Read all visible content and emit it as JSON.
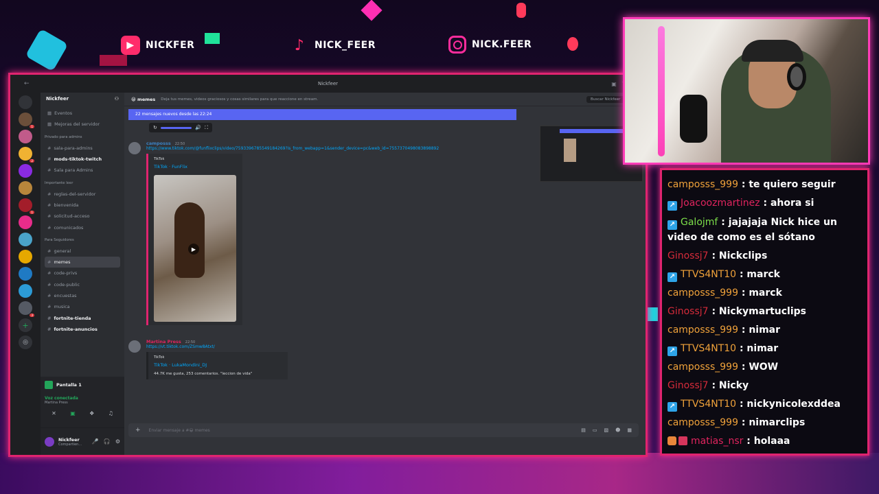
{
  "socials": {
    "youtube": "NICKFER",
    "tiktok": "NICK_FEER",
    "instagram": "NICK.FEER"
  },
  "discord": {
    "window_title": "Nickfeer",
    "server_name": "Nickfeer",
    "channels": [
      {
        "type": "item",
        "label": "Eventos"
      },
      {
        "type": "item",
        "label": "Mejoras del servidor"
      },
      {
        "type": "header",
        "label": "Privado para admins"
      },
      {
        "type": "channel",
        "label": "sala-para-admins"
      },
      {
        "type": "channel",
        "label": "mods-tiktok-twitch",
        "bold": true
      },
      {
        "type": "channel",
        "label": "Sala para Admins"
      },
      {
        "type": "header",
        "label": "Importante leer"
      },
      {
        "type": "channel",
        "label": "reglas-del-servidor"
      },
      {
        "type": "channel",
        "label": "bienvenida"
      },
      {
        "type": "channel",
        "label": "solicitud-acceso"
      },
      {
        "type": "channel",
        "label": "comunicados"
      },
      {
        "type": "header",
        "label": "Para Seguidores"
      },
      {
        "type": "channel",
        "label": "general"
      },
      {
        "type": "channel",
        "label": "memes",
        "active": true
      },
      {
        "type": "channel",
        "label": "code-privs"
      },
      {
        "type": "channel",
        "label": "code-public"
      },
      {
        "type": "channel",
        "label": "encuestas"
      },
      {
        "type": "channel",
        "label": "musica"
      },
      {
        "type": "channel",
        "label": "fortnite-tienda",
        "bold": true
      },
      {
        "type": "channel",
        "label": "fortnite-anuncios",
        "bold": true
      }
    ],
    "voice": {
      "title": "Pantalla 1",
      "status": "Voz conectada",
      "channel": "Martina Press"
    },
    "user": {
      "name": "Nickfeer",
      "status": "Compartien..."
    },
    "chat": {
      "channel": "memes",
      "topic": "Deja tus memes, videos graciosos y cosas similares para que reaccione en stream.",
      "search_placeholder": "Buscar Nickfeer",
      "new_messages": "22 mensajes nuevos desde las 22:24",
      "msg1": {
        "author": "camposss",
        "time": "22:50",
        "link": "https://www.tiktok.com/@funflixclips/video/7593396785549184269?is_from_webapp=1&sender_device=pc&web_id=7557370498083898892",
        "provider": "TikTok",
        "title": "TikTok · FunFlix"
      },
      "msg2": {
        "author": "Martina Press",
        "time": "22:50",
        "link": "https://vt.tiktok.com/ZSmw8Atxt/",
        "provider": "TikTok",
        "title": "TikTok · LukaMondini_DJ",
        "desc": "44.7K me gusta, 253 comentarios. \"leccion de vida\""
      },
      "composer_placeholder": "Enviar mensaje a #😀 memes"
    }
  },
  "twitch_chat": [
    {
      "user": "camposss_999",
      "color": "#f0a23a",
      "text": ": te quiero seguir",
      "badge": "none"
    },
    {
      "user": "Joacoozmartinez",
      "color": "#e0245e",
      "text": ": ahora si",
      "badge": "blue"
    },
    {
      "user": "Galojmf",
      "color": "#7ddf4a",
      "text": ": jajajaja Nick hice un video de como es el sótano",
      "badge": "blue",
      "wrap": true
    },
    {
      "user": "Ginossj7",
      "color": "#d52b3a",
      "text": ": Nickclips",
      "badge": "none"
    },
    {
      "user": "TTVS4NT10",
      "color": "#f0a23a",
      "text": ": marck",
      "badge": "blue"
    },
    {
      "user": "camposss_999",
      "color": "#f0a23a",
      "text": ": marck",
      "badge": "none"
    },
    {
      "user": "Ginossj7",
      "color": "#d52b3a",
      "text": ": Nickymartuclips",
      "badge": "none"
    },
    {
      "user": "camposss_999",
      "color": "#f0a23a",
      "text": ": nimar",
      "badge": "none"
    },
    {
      "user": "TTVS4NT10",
      "color": "#f0a23a",
      "text": ": nimar",
      "badge": "blue"
    },
    {
      "user": "camposss_999",
      "color": "#f0a23a",
      "text": ": WOW",
      "badge": "none"
    },
    {
      "user": "Ginossj7",
      "color": "#d52b3a",
      "text": ": Nicky",
      "badge": "none"
    },
    {
      "user": "TTVS4NT10",
      "color": "#f0a23a",
      "text": ": nickynicolexddea",
      "badge": "blue"
    },
    {
      "user": "camposss_999",
      "color": "#f0a23a",
      "text": ": nimarclips",
      "badge": "none"
    },
    {
      "user": "matias_nsr",
      "color": "#e0245e",
      "text": ": holaaa",
      "badge": "double"
    }
  ],
  "colors": {
    "accent_pink": "#e0246f",
    "discord_blurple": "#5865f2"
  }
}
